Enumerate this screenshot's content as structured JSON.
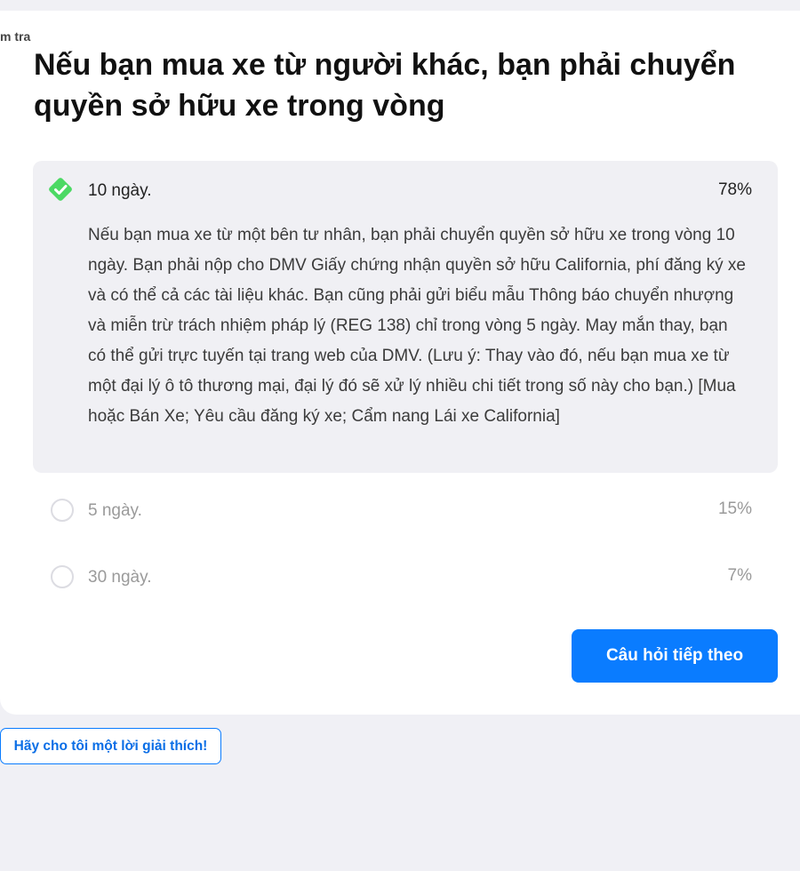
{
  "breadcrumb": "m tra",
  "question": "Nếu bạn mua xe từ người khác, bạn phải chuyển quyền sở hữu xe trong vòng",
  "answers": [
    {
      "label": "10 ngày.",
      "percent": "78%",
      "correct": true,
      "explanation": "Nếu bạn mua xe từ một bên tư nhân, bạn phải chuyển quyền sở hữu xe trong vòng 10 ngày. Bạn phải nộp cho DMV Giấy chứng nhận quyền sở hữu California, phí đăng ký xe và có thể cả các tài liệu khác. Bạn cũng phải gửi biểu mẫu Thông báo chuyển nhượng và miễn trừ trách nhiệm pháp lý (REG 138) chỉ trong vòng 5 ngày. May mắn thay, bạn có thể gửi trực tuyến tại trang web của DMV. (Lưu ý: Thay vào đó, nếu bạn mua xe từ một đại lý ô tô thương mại, đại lý đó sẽ xử lý nhiều chi tiết trong số này cho bạn.) [Mua hoặc Bán Xe; Yêu cầu đăng ký xe; Cẩm nang Lái xe California]"
    },
    {
      "label": "5 ngày.",
      "percent": "15%",
      "correct": false
    },
    {
      "label": "30 ngày.",
      "percent": "7%",
      "correct": false
    }
  ],
  "next_button": "Câu hỏi tiếp theo",
  "explain_button": "Hãy cho tôi một lời giải thích!",
  "colors": {
    "correct_check": "#4cd964",
    "primary": "#0a7cff",
    "page_bg": "#f0f0f5"
  },
  "icons": {
    "correct": "check-diamond-icon",
    "unselected": "radio-circle-icon"
  }
}
